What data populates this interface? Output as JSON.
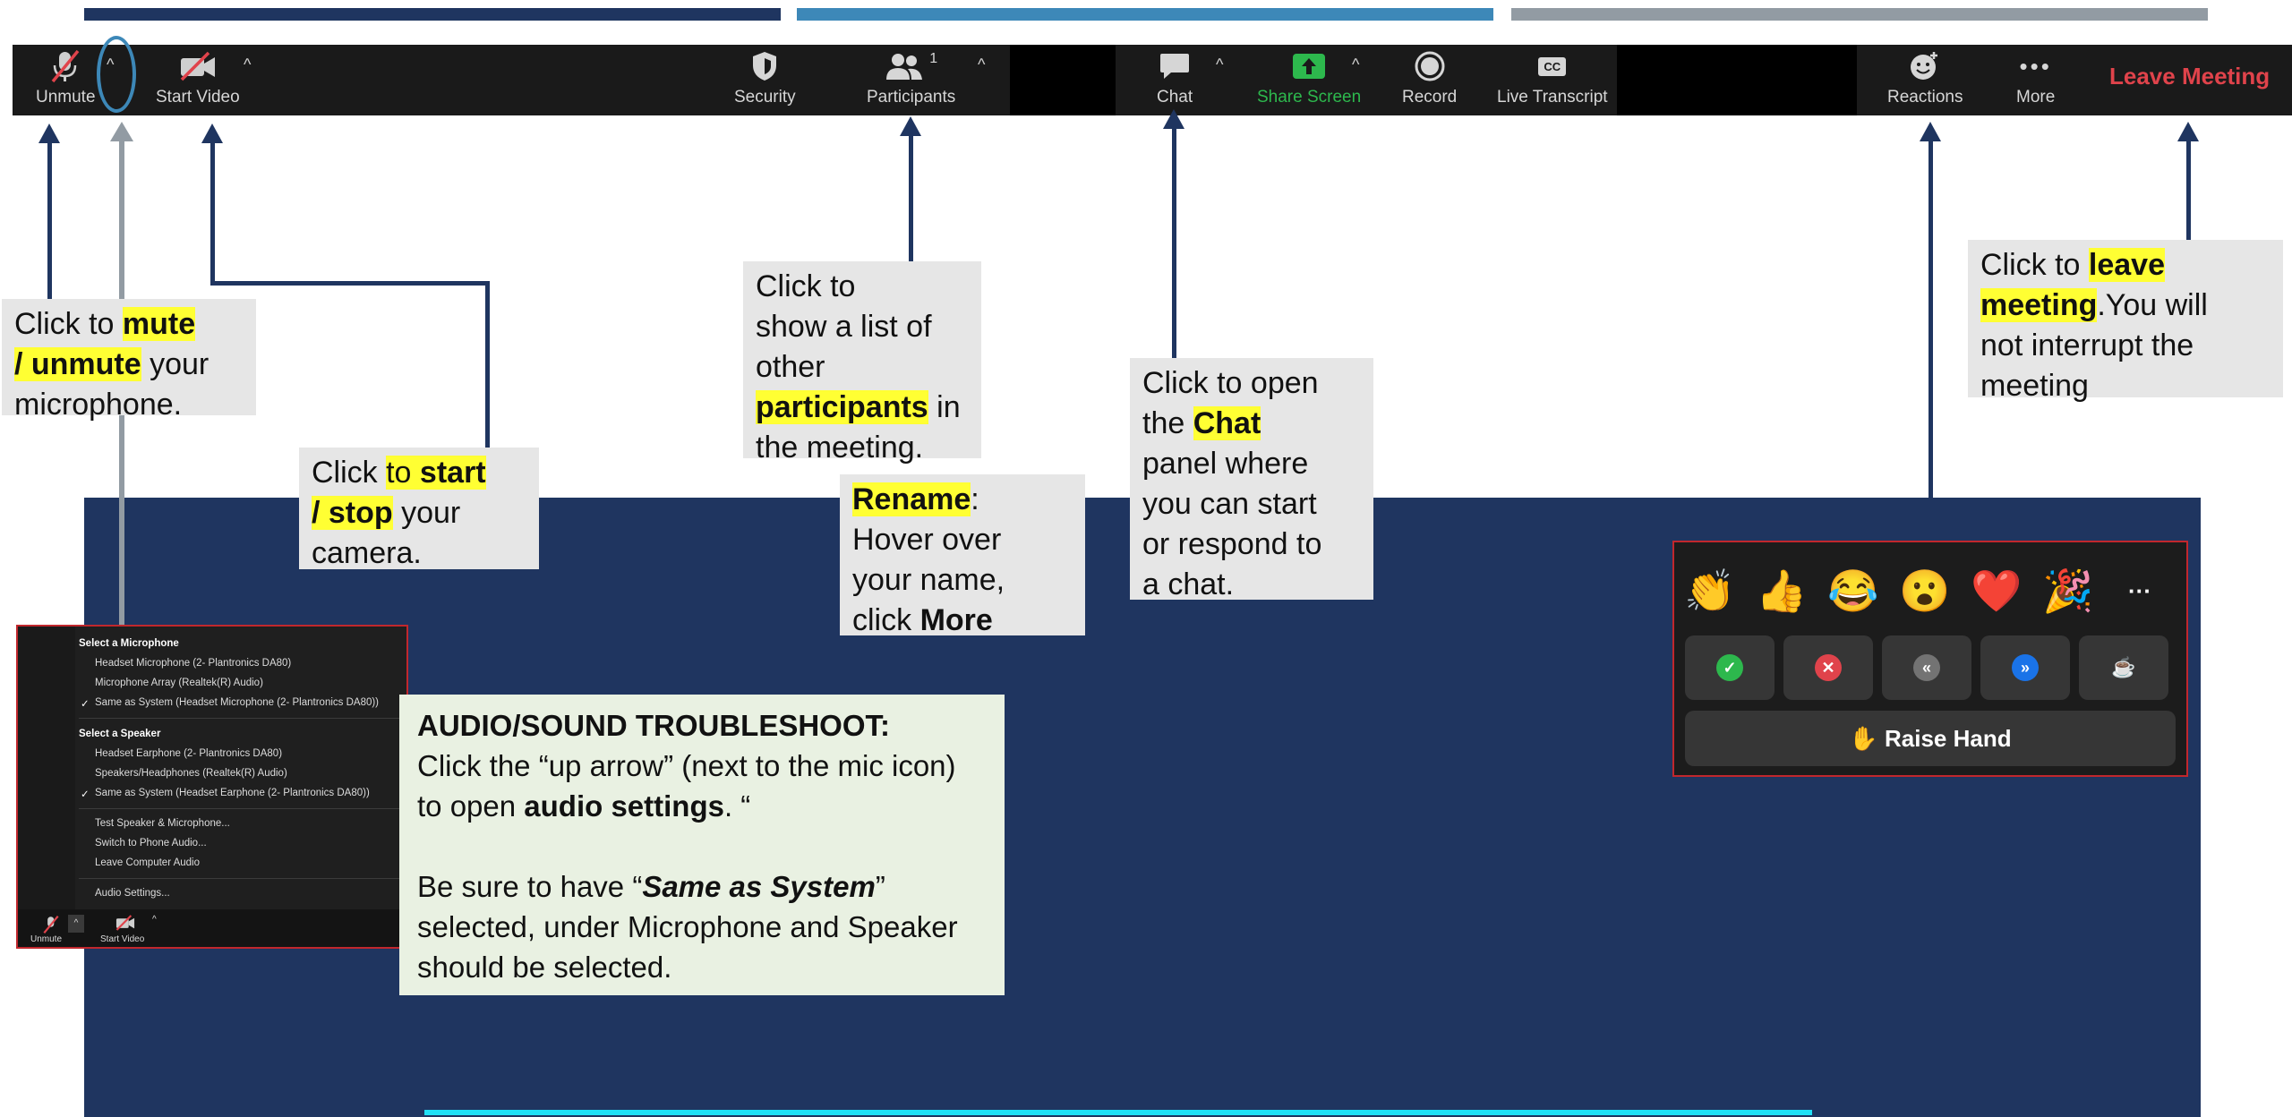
{
  "toolbar": {
    "unmute_label": "Unmute",
    "start_video_label": "Start Video",
    "security_label": "Security",
    "participants_label": "Participants",
    "participants_count": "1",
    "chat_label": "Chat",
    "share_screen_label": "Share Screen",
    "record_label": "Record",
    "live_transcript_label": "Live Transcript",
    "live_transcript_icon_text": "CC",
    "reactions_label": "Reactions",
    "more_label": "More",
    "leave_label": "Leave Meeting"
  },
  "callouts": {
    "mute": {
      "a": "Click to ",
      "b": "mute",
      "c": "/ unmute",
      "d": " your",
      "e": "microphone."
    },
    "video": {
      "a": "Click ",
      "b": "to ",
      "c": "start",
      "d": "/ stop",
      "e": " your",
      "f": "camera."
    },
    "participants": {
      "a": "Click to",
      "b": "show a list of",
      "c": "other",
      "d": "participants",
      "e": " in",
      "f": "the meeting."
    },
    "rename": {
      "a": "Rename",
      "b": ":",
      "c": "Hover over",
      "d": "your name,",
      "e": "click ",
      "f": "More"
    },
    "chat": {
      "a": "Click to open",
      "b": "the ",
      "c": "Chat",
      "d": "panel where",
      "e": "you can start",
      "f": "or respond to",
      "g": "a chat."
    },
    "leave": {
      "a": "Click to ",
      "b": "leave",
      "c": "meeting",
      "d": ".You will",
      "e": "not interrupt the",
      "f": "meeting"
    }
  },
  "audio_menu": {
    "mic_header": "Select a Microphone",
    "mic_options": [
      "Headset Microphone (2- Plantronics DA80)",
      "Microphone Array (Realtek(R) Audio)",
      "Same as System (Headset Microphone (2- Plantronics DA80))"
    ],
    "speaker_header": "Select a Speaker",
    "speaker_options": [
      "Headset Earphone (2- Plantronics DA80)",
      "Speakers/Headphones (Realtek(R) Audio)",
      "Same as System (Headset Earphone (2- Plantronics DA80))"
    ],
    "actions": [
      "Test Speaker & Microphone...",
      "Switch to Phone Audio...",
      "Leave Computer Audio"
    ],
    "settings": "Audio Settings...",
    "unmute": "Unmute",
    "start_video": "Start Video",
    "check": "✓"
  },
  "troubleshoot": {
    "title": "AUDIO/SOUND TROUBLESHOOT:",
    "l1": "Click the “up arrow” (next to the mic icon)",
    "l2a": "to open ",
    "l2b": "audio settings",
    "l2c": ". “",
    "l3a": "Be sure to have “",
    "l3b": "Same as System",
    "l3c": "”",
    "l4": "selected, under Microphone and Speaker",
    "l5": "should be selected."
  },
  "reactions": {
    "emojis": [
      "👏",
      "👍",
      "😂",
      "😮",
      "❤️",
      "🎉",
      "···"
    ],
    "buttons": [
      {
        "symbol": "✓",
        "color": "#2db84d"
      },
      {
        "symbol": "✕",
        "color": "#e0434b"
      },
      {
        "symbol": "«",
        "color": "#737373"
      },
      {
        "symbol": "»",
        "color": "#1a73e8"
      },
      {
        "symbol": "☕",
        "color": "#363636"
      }
    ],
    "raise_hand": "✋ Raise Hand"
  },
  "colors": {
    "navy": "#1f3560",
    "blue": "#3d88b8",
    "gray": "#929ba3",
    "highlight": "#ffff33",
    "leave_red": "#e0434b",
    "share_green": "#2db84d",
    "cyan": "#21e0f5"
  }
}
